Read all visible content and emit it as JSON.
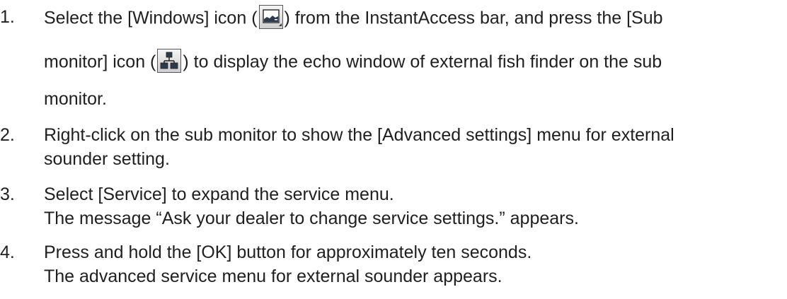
{
  "steps": [
    {
      "number": "1.",
      "line1_a": "Select the [Windows] icon (",
      "line1_b": ") from the InstantAccess bar, and press the [Sub",
      "line2_a": "monitor] icon (",
      "line2_b": ") to display the echo window of external fish finder on the sub",
      "line3": "monitor.",
      "icons": [
        "windows-icon",
        "sub-monitor-icon"
      ]
    },
    {
      "number": "2.",
      "line1": "Right-click on the sub monitor to show the [Advanced settings] menu for external",
      "line2": "sounder setting."
    },
    {
      "number": "3.",
      "line1": "Select [Service] to expand the service menu.",
      "line2": "The message “Ask your dealer to change service settings.” appears."
    },
    {
      "number": "4.",
      "line1": "Press and hold the [OK] button for approximately ten seconds.",
      "line2": "The advanced service menu for external sounder appears."
    }
  ]
}
